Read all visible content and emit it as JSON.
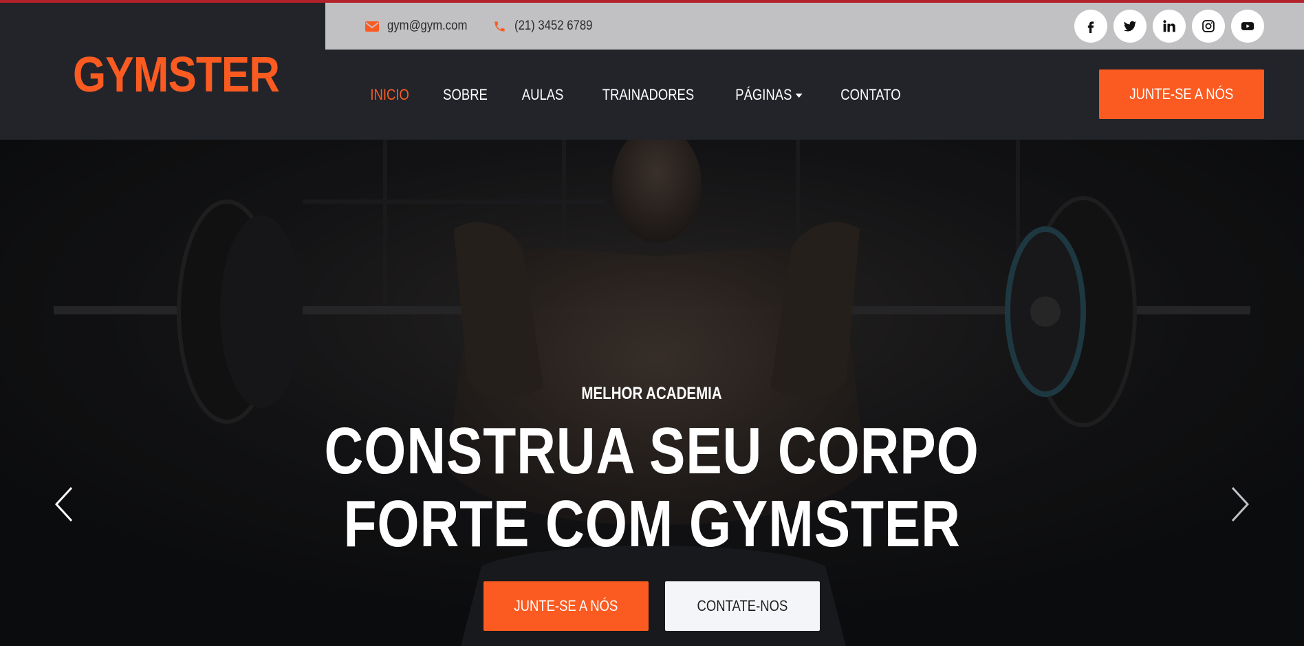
{
  "colors": {
    "accent": "#fb5b21",
    "dark": "#22242a",
    "topbar": "#c1c1c4",
    "top_stripe": "#b3212b"
  },
  "brand": {
    "logo": "GYMSTER"
  },
  "topbar": {
    "email": {
      "icon": "envelope-icon",
      "text": "gym@gym.com"
    },
    "phone": {
      "icon": "phone-icon",
      "text": "(21) 3452 6789"
    },
    "social": [
      "facebook-icon",
      "twitter-icon",
      "linkedin-icon",
      "instagram-icon",
      "youtube-icon"
    ]
  },
  "nav": {
    "items": [
      {
        "label": "INICIO",
        "active": true
      },
      {
        "label": "SOBRE"
      },
      {
        "label": "AULAS"
      },
      {
        "label": "TRAINADORES"
      },
      {
        "label": "PÁGINAS",
        "dropdown": true
      },
      {
        "label": "CONTATO"
      }
    ],
    "cta": "JUNTE-SE A NÓS"
  },
  "hero": {
    "kicker": "MELHOR ACADEMIA",
    "headline_line1": "CONSTRUA SEU CORPO",
    "headline_line2": "FORTE COM GYMSTER",
    "primary_button": "JUNTE-SE A NÓS",
    "secondary_button": "CONTATE-NOS",
    "prev_icon": "chevron-left-icon",
    "next_icon": "chevron-right-icon"
  }
}
